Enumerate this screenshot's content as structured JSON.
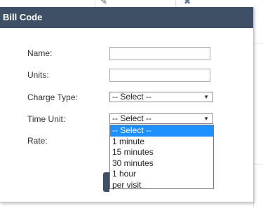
{
  "background": {
    "edit_icon": "pencil-icon",
    "delete_icon": "x-icon"
  },
  "dialog": {
    "title": "Bill Code",
    "fields": {
      "name_label": "Name:",
      "name_value": "",
      "units_label": "Units:",
      "units_value": "",
      "charge_type_label": "Charge Type:",
      "charge_type_value": "-- Select --",
      "time_unit_label": "Time Unit:",
      "time_unit_value": "-- Select --",
      "rate_label": "Rate:"
    },
    "time_unit_options": [
      "-- Select --",
      "1 minute",
      "15 minutes",
      "30 minutes",
      "1 hour",
      "per visit"
    ],
    "highlighted_option_index": 0
  },
  "colors": {
    "header_bg": "#3f5066",
    "header_text": "#ffffff",
    "highlight": "#1e90ff"
  }
}
